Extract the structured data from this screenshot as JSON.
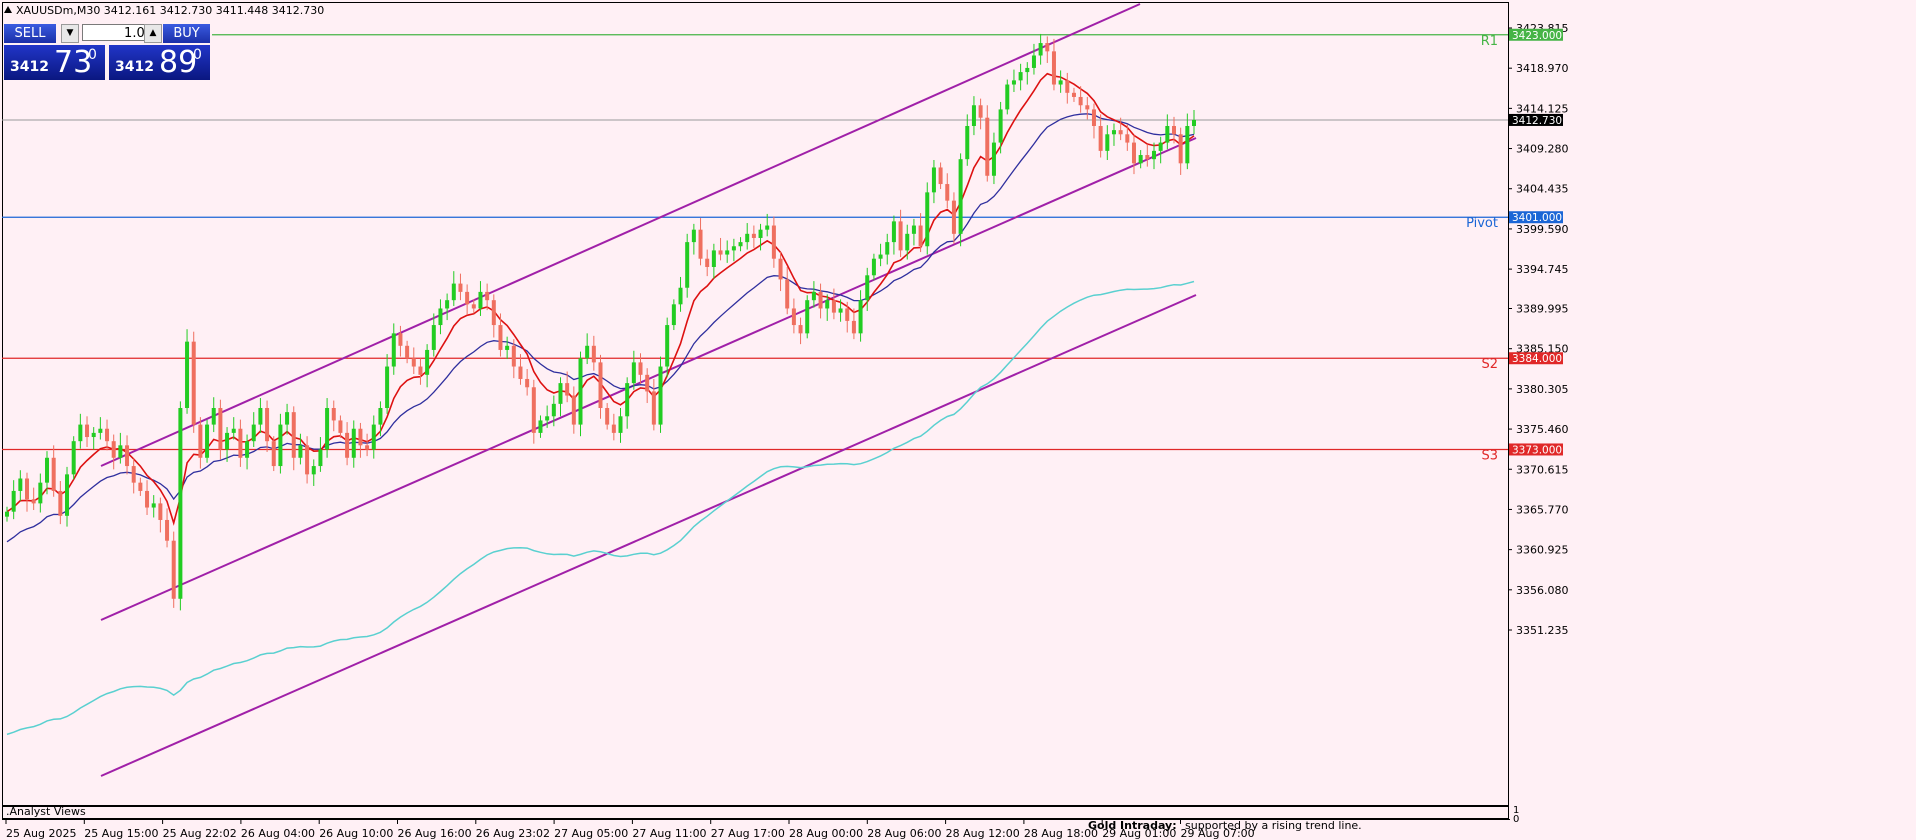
{
  "header": {
    "symbol_info": "XAUUSDm,M30  3412.161 3412.730 3411.448 3412.730"
  },
  "trade_panel": {
    "sell_label": "SELL",
    "buy_label": "BUY",
    "lot": "1.00",
    "sell_price_small": "3412",
    "sell_price_big": "73",
    "sell_price_sup": "0",
    "buy_price_small": "3412",
    "buy_price_big": "89",
    "buy_price_sup": "0"
  },
  "indicator_panel": {
    "label": ".Analyst Views",
    "title": "Gold Intraday:",
    "text": "supported by a rising trend line.",
    "scale_top": "1",
    "scale_bottom": "0"
  },
  "colors": {
    "background": "#fff0f5",
    "bull": "#22cc22",
    "bear": "#ef6f5f",
    "channel": "#a020a8",
    "ema_fast": "#dd1111",
    "ema_mid": "#2f2f9e",
    "ema_slow": "#5ad0d0",
    "r1": "#46b446",
    "pivot": "#1b66d6",
    "support": "#e02828"
  },
  "chart_data": {
    "type": "candlestick",
    "symbol": "XAUUSDm",
    "timeframe": "M30",
    "ylim": [
      3347,
      3425
    ],
    "y_ticks": [
      "3423.815",
      "3418.970",
      "3414.125",
      "3409.280",
      "3404.435",
      "3399.590",
      "3394.745",
      "3389.995",
      "3385.150",
      "3380.305",
      "3375.460",
      "3370.615",
      "3365.770",
      "3360.925",
      "3356.080",
      "3351.235"
    ],
    "x_ticks": [
      "25 Aug 2025",
      "25 Aug 15:00",
      "25 Aug 22:02",
      "26 Aug 04:00",
      "26 Aug 10:00",
      "26 Aug 16:00",
      "26 Aug 23:02",
      "27 Aug 05:00",
      "27 Aug 11:00",
      "27 Aug 17:00",
      "28 Aug 00:00",
      "28 Aug 06:00",
      "28 Aug 12:00",
      "28 Aug 18:00",
      "29 Aug 01:00",
      "29 Aug 07:00"
    ],
    "current_price": {
      "value": 3412.73,
      "label": "3412.730"
    },
    "levels": [
      {
        "name": "R1",
        "value": 3423.0,
        "label": "3423.000",
        "color": "#46b446"
      },
      {
        "name": "Pivot",
        "value": 3401.0,
        "label": "3401.000",
        "color": "#1b66d6"
      },
      {
        "name": "S2",
        "value": 3384.0,
        "label": "3384.000",
        "color": "#e02828"
      },
      {
        "name": "S3",
        "value": 3373.0,
        "label": "3373.000",
        "color": "#e02828"
      }
    ],
    "candles_close": [
      3365.5,
      3368.0,
      3369.5,
      3367.0,
      3366.5,
      3369.0,
      3372.0,
      3368.0,
      3365.0,
      3370.0,
      3374.0,
      3376.0,
      3374.5,
      3375.0,
      3375.5,
      3374.0,
      3372.0,
      3373.5,
      3371.0,
      3369.0,
      3368.0,
      3366.0,
      3366.5,
      3364.5,
      3362.0,
      3355.0,
      3378.0,
      3386.0,
      3376.0,
      3372.0,
      3376.0,
      3378.0,
      3373.0,
      3375.0,
      3375.5,
      3372.0,
      3374.0,
      3376.0,
      3378.0,
      3374.0,
      3371.0,
      3376.0,
      3377.5,
      3372.0,
      3373.5,
      3370.0,
      3371.0,
      3373.0,
      3378.0,
      3376.5,
      3375.0,
      3372.0,
      3375.5,
      3373.5,
      3373.0,
      3376.0,
      3378.0,
      3383.0,
      3387.0,
      3385.5,
      3384.0,
      3383.0,
      3382.0,
      3385.0,
      3388.0,
      3390.0,
      3391.0,
      3393.0,
      3392.0,
      3390.5,
      3390.0,
      3392.0,
      3391.0,
      3388.0,
      3385.0,
      3385.5,
      3383.0,
      3381.5,
      3380.5,
      3375.0,
      3376.5,
      3377.0,
      3378.5,
      3381.0,
      3379.5,
      3376.0,
      3384.0,
      3385.5,
      3383.5,
      3378.0,
      3376.0,
      3375.0,
      3377.0,
      3381.0,
      3383.5,
      3382.0,
      3380.0,
      3376.0,
      3383.0,
      3388.0,
      3390.5,
      3392.5,
      3398.0,
      3399.5,
      3396.0,
      3395.0,
      3397.0,
      3396.5,
      3397.0,
      3397.5,
      3398.0,
      3399.0,
      3398.5,
      3399.5,
      3400.0,
      3396.0,
      3393.5,
      3390.0,
      3388.0,
      3387.0,
      3391.0,
      3392.0,
      3390.0,
      3391.0,
      3389.5,
      3390.0,
      3388.5,
      3387.0,
      3391.0,
      3394.0,
      3396.0,
      3396.5,
      3398.0,
      3400.5,
      3397.0,
      3399.0,
      3400.0,
      3397.5,
      3404.0,
      3407.0,
      3405.0,
      3403.0,
      3399.0,
      3408.0,
      3412.0,
      3414.5,
      3413.0,
      3406.0,
      3410.0,
      3414.0,
      3417.0,
      3417.5,
      3418.5,
      3419.0,
      3420.5,
      3422.0,
      3421.0,
      3417.0,
      3417.5,
      3416.0,
      3415.5,
      3414.5,
      3414.0,
      3412.0,
      3409.0,
      3411.0,
      3411.5,
      3411.0,
      3410.0,
      3407.5,
      3408.5,
      3408.0,
      3409.0,
      3410.0,
      3412.0,
      3411.0,
      3407.5,
      3412.0,
      3412.73
    ]
  }
}
